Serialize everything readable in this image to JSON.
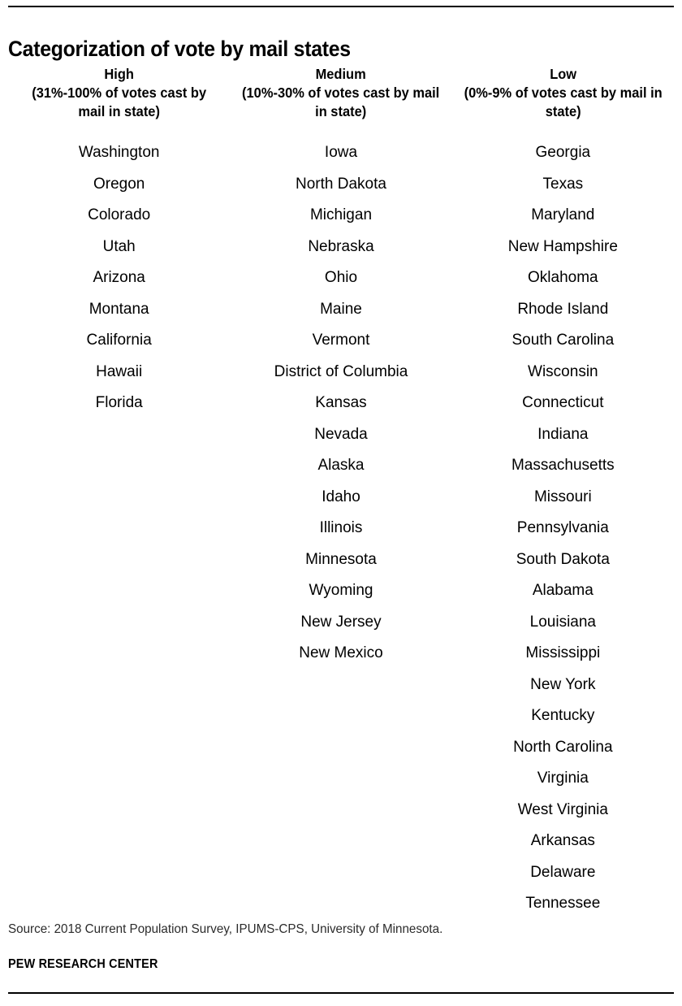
{
  "title": "Categorization of vote by mail states",
  "columns": [
    {
      "key": "high",
      "label": "High",
      "range": "(31%-100% of votes cast by mail in state)",
      "states": [
        "Washington",
        "Oregon",
        "Colorado",
        "Utah",
        "Arizona",
        "Montana",
        "California",
        "Hawaii",
        "Florida"
      ]
    },
    {
      "key": "medium",
      "label": "Medium",
      "range": "(10%-30% of votes cast by mail in state)",
      "states": [
        "Iowa",
        "North Dakota",
        "Michigan",
        "Nebraska",
        "Ohio",
        "Maine",
        "Vermont",
        "District of Columbia",
        "Kansas",
        "Nevada",
        "Alaska",
        "Idaho",
        "Illinois",
        "Minnesota",
        "Wyoming",
        "New Jersey",
        "New Mexico"
      ]
    },
    {
      "key": "low",
      "label": "Low",
      "range": "(0%-9% of votes cast by mail in state)",
      "states": [
        "Georgia",
        "Texas",
        "Maryland",
        "New Hampshire",
        "Oklahoma",
        "Rhode Island",
        "South Carolina",
        "Wisconsin",
        "Connecticut",
        "Indiana",
        "Massachusetts",
        "Missouri",
        "Pennsylvania",
        "South Dakota",
        "Alabama",
        "Louisiana",
        "Mississippi",
        "New York",
        "Kentucky",
        "North Carolina",
        "Virginia",
        "West Virginia",
        "Arkansas",
        "Delaware",
        "Tennessee"
      ]
    }
  ],
  "footer": {
    "source": "Source: 2018 Current Population Survey, IPUMS-CPS, University of Minnesota.",
    "brand": "PEW RESEARCH CENTER"
  },
  "chart_data": {
    "type": "table",
    "title": "Categorization of vote by mail states",
    "columns": [
      "High",
      "Medium",
      "Low"
    ],
    "column_definitions": [
      "(31%-100% of votes cast by mail in state)",
      "(10%-30% of votes cast by mail in state)",
      "(0%-9% of votes cast by mail in state)"
    ],
    "counts": [
      9,
      17,
      25
    ],
    "series": [
      {
        "name": "High",
        "range_low_pct": 31,
        "range_high_pct": 100,
        "values": [
          "Washington",
          "Oregon",
          "Colorado",
          "Utah",
          "Arizona",
          "Montana",
          "California",
          "Hawaii",
          "Florida"
        ]
      },
      {
        "name": "Medium",
        "range_low_pct": 10,
        "range_high_pct": 30,
        "values": [
          "Iowa",
          "North Dakota",
          "Michigan",
          "Nebraska",
          "Ohio",
          "Maine",
          "Vermont",
          "District of Columbia",
          "Kansas",
          "Nevada",
          "Alaska",
          "Idaho",
          "Illinois",
          "Minnesota",
          "Wyoming",
          "New Jersey",
          "New Mexico"
        ]
      },
      {
        "name": "Low",
        "range_low_pct": 0,
        "range_high_pct": 9,
        "values": [
          "Georgia",
          "Texas",
          "Maryland",
          "New Hampshire",
          "Oklahoma",
          "Rhode Island",
          "South Carolina",
          "Wisconsin",
          "Connecticut",
          "Indiana",
          "Massachusetts",
          "Missouri",
          "Pennsylvania",
          "South Dakota",
          "Alabama",
          "Louisiana",
          "Mississippi",
          "New York",
          "Kentucky",
          "North Carolina",
          "Virginia",
          "West Virginia",
          "Arkansas",
          "Delaware",
          "Tennessee"
        ]
      }
    ],
    "xlabel": "",
    "ylabel": "",
    "grid": false,
    "legend": "none",
    "source": "Source: 2018 Current Population Survey, IPUMS-CPS, University of Minnesota.",
    "publisher": "PEW RESEARCH CENTER"
  }
}
